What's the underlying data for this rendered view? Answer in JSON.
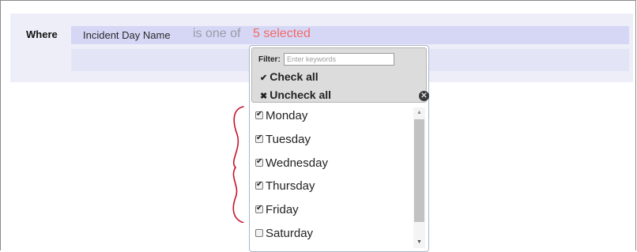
{
  "where": {
    "label": "Where",
    "field": "Incident Day Name",
    "operator": "is one of",
    "summary": "5 selected"
  },
  "dropdown": {
    "filter_label": "Filter:",
    "filter_placeholder": "Enter keywords",
    "filter_value": "",
    "check_all_label": "Check all",
    "uncheck_all_label": "Uncheck all",
    "close_icon": "close-icon",
    "options": [
      {
        "label": "Monday",
        "checked": true
      },
      {
        "label": "Tuesday",
        "checked": true
      },
      {
        "label": "Wednesday",
        "checked": true
      },
      {
        "label": "Thursday",
        "checked": true
      },
      {
        "label": "Friday",
        "checked": true
      },
      {
        "label": "Saturday",
        "checked": false
      }
    ]
  },
  "colors": {
    "summary": "#f26a6a",
    "panel": "#eeeef9",
    "condition_bar": "#d5d7f5",
    "annotation": "#c8102e"
  }
}
